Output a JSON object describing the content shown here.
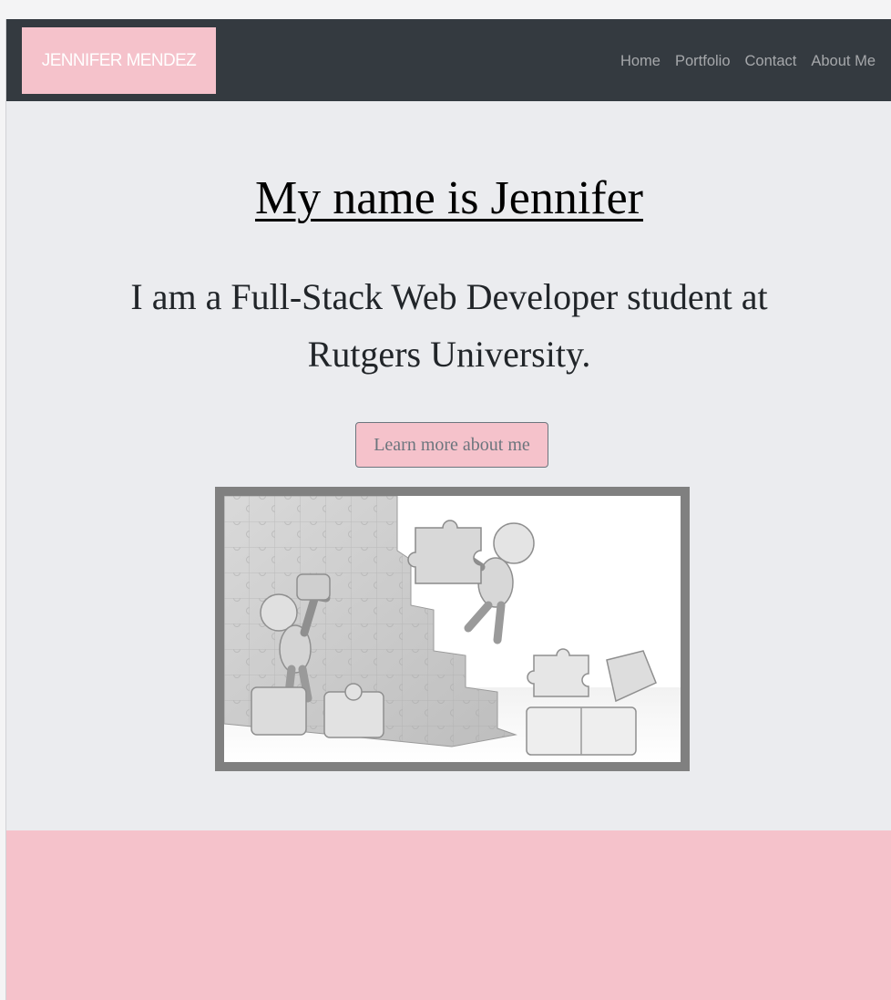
{
  "navbar": {
    "brand": "JENNIFER MENDEZ",
    "links": [
      {
        "label": "Home"
      },
      {
        "label": "Portfolio"
      },
      {
        "label": "Contact"
      },
      {
        "label": "About Me"
      }
    ]
  },
  "hero": {
    "title": "My name is Jennifer",
    "subtitle": "I am a Full-Stack Web Developer student at Rutgers University.",
    "button_label": "Learn more about me",
    "image_icon": "puzzle-wall-illustration"
  },
  "colors": {
    "navbar_bg": "#343a40",
    "accent_pink": "#f5c2cb",
    "page_bg": "#ebecef",
    "image_border": "#808080"
  }
}
